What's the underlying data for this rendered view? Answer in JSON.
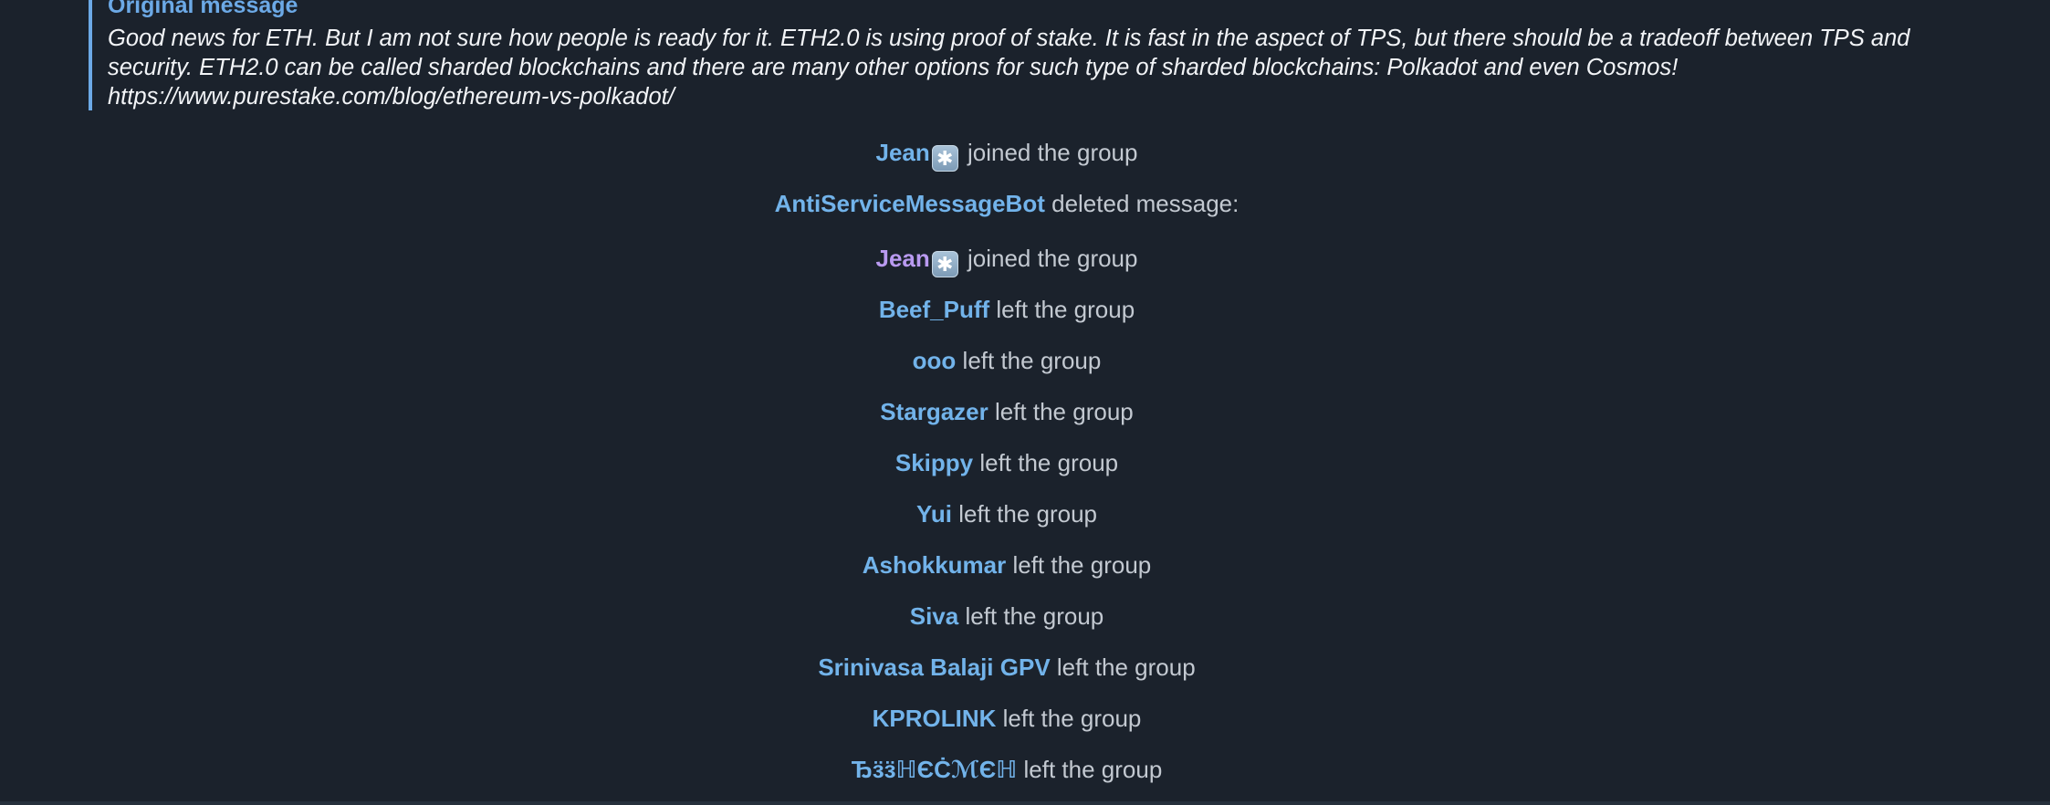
{
  "reply": {
    "title": "Original message",
    "text": "Good news for ETH. But I am not sure how people is ready for it. ETH2.0 is using proof of stake. It is fast in the aspect of TPS, but there should be a tradeoff between TPS and security. ETH2.0 can be called sharded blockchains and there are many other options for such type of sharded blockchains: Polkadot and even Cosmos! https://www.purestake.com/blog/ethereum-vs-polkadot/"
  },
  "service_messages": [
    {
      "name": "Jean",
      "badge": "✱",
      "action": "joined the group",
      "name_color": "blue"
    },
    {
      "name": "AntiServiceMessageBot",
      "action": "deleted message:",
      "name_color": "blue"
    },
    {
      "name": "Jean",
      "badge": "✱",
      "action": "joined the group",
      "name_color": "purple"
    },
    {
      "name": "Beef_Puff",
      "action": "left the group",
      "name_color": "blue"
    },
    {
      "name": "ooo",
      "action": "left the group",
      "name_color": "blue"
    },
    {
      "name": "Stargazer",
      "action": "left the group",
      "name_color": "blue"
    },
    {
      "name": "Skippy",
      "action": "left the group",
      "name_color": "blue"
    },
    {
      "name": "Yui",
      "action": "left the group",
      "name_color": "blue"
    },
    {
      "name": "Ashokkumar",
      "action": "left the group",
      "name_color": "blue"
    },
    {
      "name": "Siva",
      "action": "left the group",
      "name_color": "blue"
    },
    {
      "name": "Srinivasa Balaji GPV",
      "action": "left the group",
      "name_color": "blue"
    },
    {
      "name": "KPROLINK",
      "action": "left the group",
      "name_color": "blue"
    },
    {
      "name": "ЂӟӟℍЄĊℳЄℍ",
      "action": "left the group",
      "name_color": "blue"
    }
  ],
  "colors": {
    "background": "#1b222c",
    "accent": "#6ca9e6",
    "name_blue": "#72b3ea",
    "name_purple": "#b99af0",
    "action_text": "#c3c9d1"
  }
}
